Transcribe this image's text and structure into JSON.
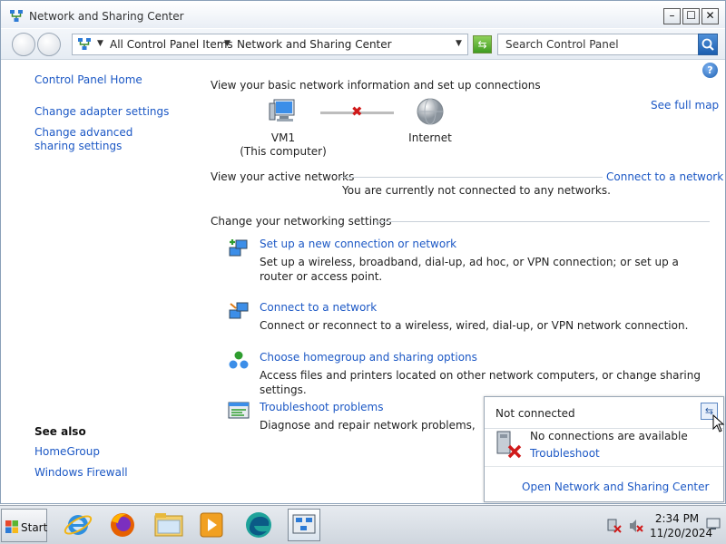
{
  "window": {
    "title": "Network and Sharing Center",
    "min_symbol": "–",
    "max_symbol": "☐",
    "close_symbol": "✕"
  },
  "address": {
    "crumbs": [
      "All Control Panel Items",
      "Network and Sharing Center"
    ],
    "search_placeholder": "Search Control Panel"
  },
  "left_pane": {
    "links": [
      "Control Panel Home",
      "Change adapter settings",
      "Change advanced sharing settings"
    ],
    "see_also_title": "See also",
    "see_also_links": [
      "HomeGroup",
      "Windows Firewall"
    ]
  },
  "main": {
    "help_symbol": "?",
    "basic_info_heading": "View your basic network information and set up connections",
    "see_full_map": "See full map",
    "computer_name": "VM1",
    "computer_caption": "(This computer)",
    "internet_label": "Internet",
    "active_networks_heading": "View your active networks",
    "connect_to_network_link": "Connect to a network",
    "not_connected_message": "You are currently not connected to any networks.",
    "change_settings_heading": "Change your networking settings",
    "tasks": [
      {
        "title": "Set up a new connection or network",
        "desc": "Set up a wireless, broadband, dial-up, ad hoc, or VPN connection; or set up a router or access point.",
        "icon": "new-connection-icon"
      },
      {
        "title": "Connect to a network",
        "desc": "Connect or reconnect to a wireless, wired, dial-up, or VPN network connection.",
        "icon": "connect-network-icon"
      },
      {
        "title": "Choose homegroup and sharing options",
        "desc": "Access files and printers located on other network computers, or change sharing settings.",
        "icon": "homegroup-icon"
      },
      {
        "title": "Troubleshoot problems",
        "desc": "Diagnose and repair network problems, or get t",
        "icon": "troubleshoot-icon"
      }
    ]
  },
  "popup": {
    "header": "Not connected",
    "no_connections": "No connections are available",
    "troubleshoot": "Troubleshoot",
    "open_center": "Open Network and Sharing Center"
  },
  "taskbar": {
    "start_label": "Start",
    "clock_time": "2:34 PM",
    "clock_date": "11/20/2024"
  },
  "colors": {
    "link": "#1c58c5",
    "error_red": "#d01a1a"
  }
}
